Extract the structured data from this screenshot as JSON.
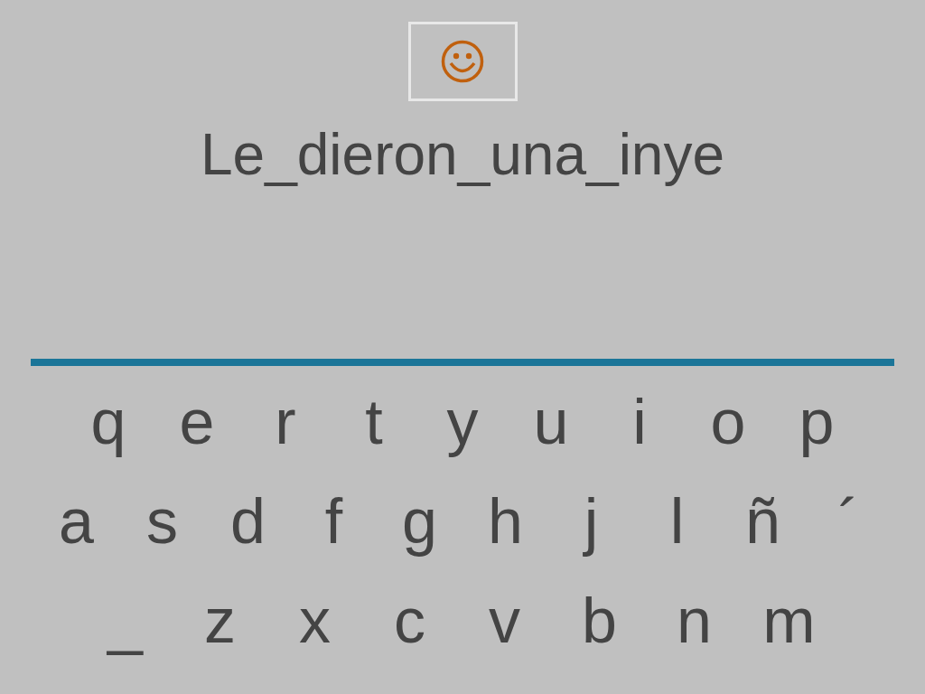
{
  "phrase": "Le_dieron_una_inye",
  "keyboard": [
    [
      "q",
      "e",
      "r",
      "t",
      "y",
      "u",
      "i",
      "o",
      "p"
    ],
    [
      "a",
      "s",
      "d",
      "f",
      "g",
      "h",
      "j",
      "l",
      "ñ",
      "´"
    ],
    [
      "_",
      "z",
      "x",
      "c",
      "v",
      "b",
      "n",
      "m"
    ]
  ]
}
